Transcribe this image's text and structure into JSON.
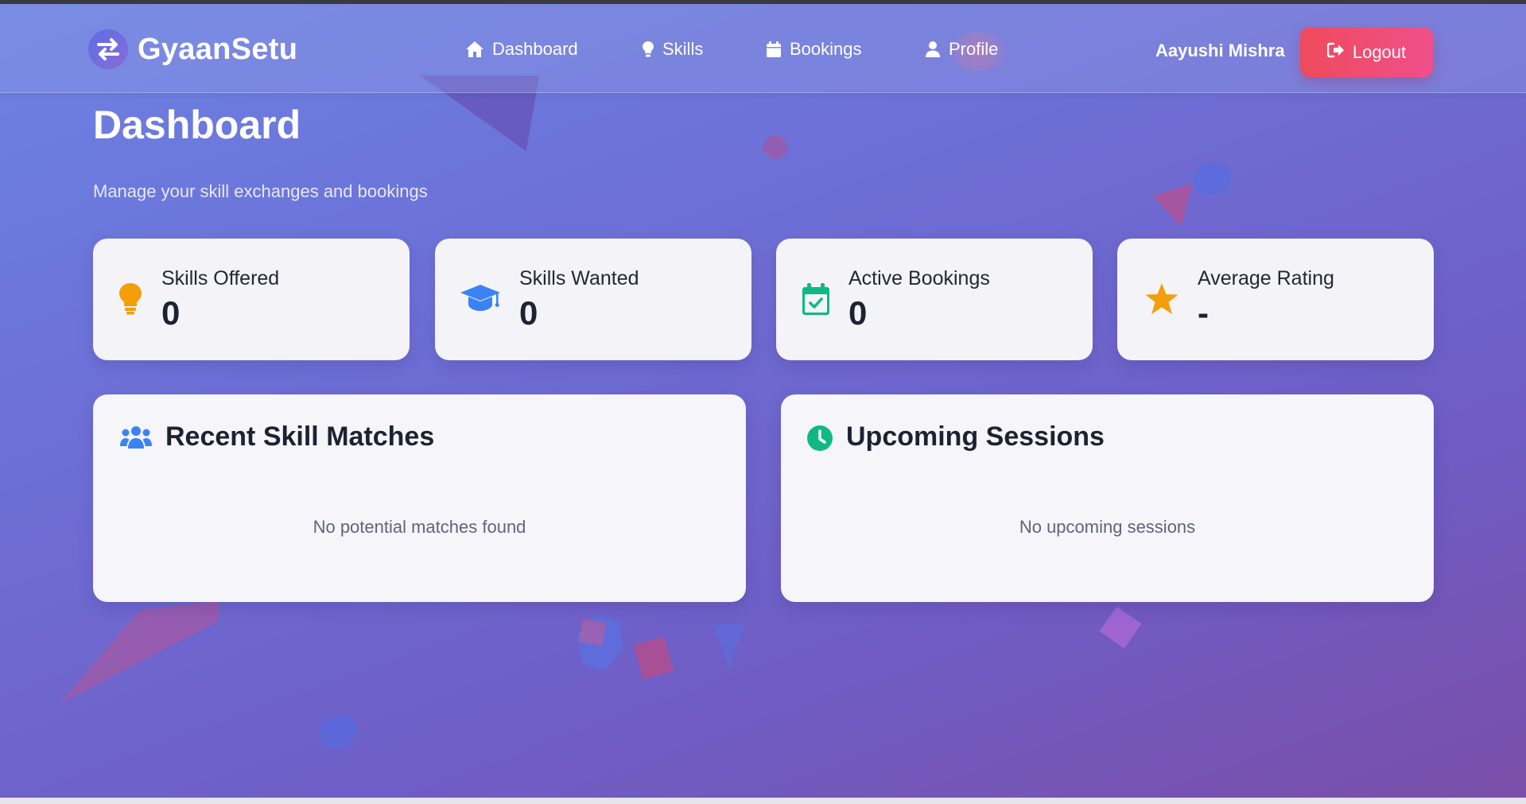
{
  "app": {
    "brand_name": "GyaanSetu"
  },
  "nav": {
    "items": [
      {
        "label": "Dashboard",
        "icon": "home-icon"
      },
      {
        "label": "Skills",
        "icon": "lightbulb-icon"
      },
      {
        "label": "Bookings",
        "icon": "calendar-icon"
      },
      {
        "label": "Profile",
        "icon": "user-icon"
      }
    ]
  },
  "user": {
    "name": "Aayushi Mishra",
    "logout_label": "Logout"
  },
  "page": {
    "title": "Dashboard",
    "subtitle": "Manage your skill exchanges and bookings"
  },
  "stats": [
    {
      "label": "Skills Offered",
      "value": "0",
      "icon": "lightbulb-icon",
      "color": "#f59e0b"
    },
    {
      "label": "Skills Wanted",
      "value": "0",
      "icon": "graduation-cap-icon",
      "color": "#3b82f6"
    },
    {
      "label": "Active Bookings",
      "value": "0",
      "icon": "calendar-check-icon",
      "color": "#10b981"
    },
    {
      "label": "Average Rating",
      "value": "-",
      "icon": "star-icon",
      "color": "#f59e0b"
    }
  ],
  "panels": {
    "matches": {
      "title": "Recent Skill Matches",
      "empty_text": "No potential matches found",
      "icon": "users-icon",
      "color": "#3b82f6"
    },
    "sessions": {
      "title": "Upcoming Sessions",
      "empty_text": "No upcoming sessions",
      "icon": "clock-icon",
      "color": "#10b981"
    }
  },
  "colors": {
    "logout_start": "#ee4b5c",
    "logout_end": "#f04f8a",
    "card_bg": "#f4f4f8"
  }
}
